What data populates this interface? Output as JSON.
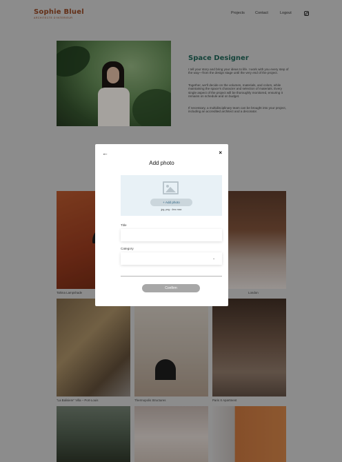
{
  "header": {
    "logo_name": "Sophie Bluel",
    "logo_sub": "ARCHITECTE D'INTERIEUR",
    "nav": {
      "projects": "Projects",
      "contact": "Contact",
      "logout": "Logout"
    },
    "instagram_icon": "instagram-icon"
  },
  "intro": {
    "title": "Space Designer",
    "paragraphs": [
      "I tell your story and bring your ideas to life. I work with you every step of the way—from the design stage until the very end of the project.",
      "Together, we'll decide on the volumes, materials, and colors, while maintaining the space's character and selection of materials. Every single aspect of the project will be thoroughly monitored, ensuring it remains on schedule and on budget.",
      "If necessary, a multidisciplinary team can be brought into your project, including an accredited architect and a decorator."
    ]
  },
  "gallery": [
    {
      "caption": "Tahina Lampshade"
    },
    {
      "caption": ""
    },
    {
      "caption": "London"
    },
    {
      "caption": "\"La Balisiere\" Villa – Port-Louis"
    },
    {
      "caption": "Thermopolis Structures"
    },
    {
      "caption": "Paris X Apartment"
    },
    {
      "caption": ""
    },
    {
      "caption": ""
    },
    {
      "caption": ""
    }
  ],
  "modal": {
    "title": "Add photo",
    "back_icon": "arrow-left-icon",
    "close_label": "×",
    "upload": {
      "icon": "image-icon",
      "button_label": "+ Add photo",
      "hint": "jpg, png : 4mo max"
    },
    "fields": {
      "title_label": "Title",
      "title_value": "",
      "category_label": "Category",
      "category_value": ""
    },
    "confirm_label": "Confirm"
  }
}
